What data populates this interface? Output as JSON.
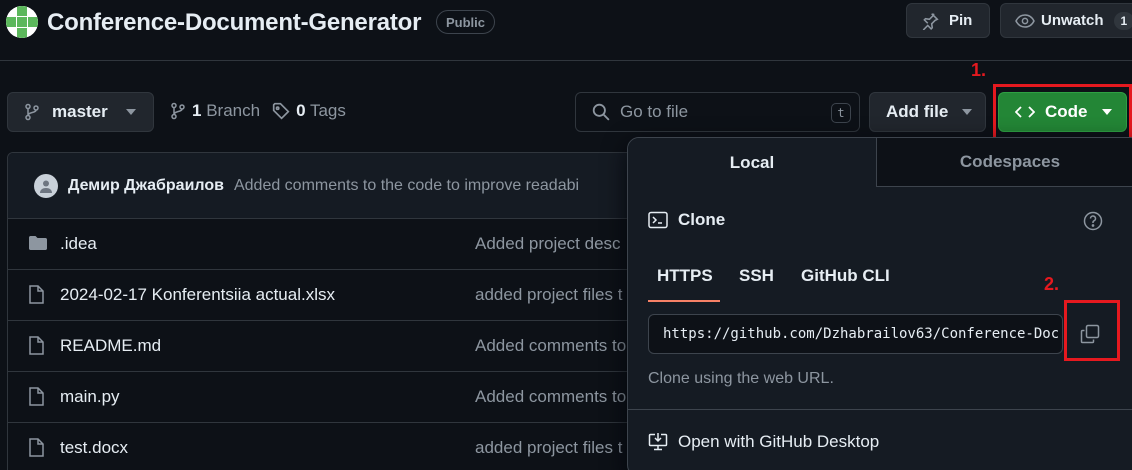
{
  "repo": {
    "name": "Conference-Document-Generator",
    "visibility": "Public"
  },
  "actions": {
    "pin_label": "Pin",
    "watch_label": "Unwatch",
    "watch_count": "1"
  },
  "branch": {
    "current": "master",
    "branch_count": "1",
    "branch_word": "Branch",
    "tag_count": "0",
    "tag_word": "Tags"
  },
  "search": {
    "placeholder": "Go to file",
    "shortcut": "t"
  },
  "buttons": {
    "add_file": "Add file",
    "code": "Code"
  },
  "commit": {
    "author": "Демир Джабраилов",
    "message": "Added comments to the code to improve readabi"
  },
  "files": [
    {
      "name": ".idea",
      "type": "folder",
      "message": "Added project desc"
    },
    {
      "name": "2024-02-17 Konferentsiia actual.xlsx",
      "type": "file",
      "message": "added project files t"
    },
    {
      "name": "README.md",
      "type": "file",
      "message": "Added comments to"
    },
    {
      "name": "main.py",
      "type": "file",
      "message": "Added comments to"
    },
    {
      "name": "test.docx",
      "type": "file",
      "message": "added project files t"
    }
  ],
  "code_panel": {
    "tabs": [
      "Local",
      "Codespaces"
    ],
    "clone_title": "Clone",
    "protocols": [
      "HTTPS",
      "SSH",
      "GitHub CLI"
    ],
    "active_protocol": "HTTPS",
    "url": "https://github.com/Dzhabrailov63/Conference-Doc",
    "hint": "Clone using the web URL.",
    "open_desktop": "Open with GitHub Desktop"
  },
  "annotations": {
    "marker_1": "1.",
    "marker_2": "2.",
    "color": "#e5191f"
  },
  "colors": {
    "background": "#0d1117",
    "primary_button": "#238636",
    "active_tab_underline": "#f78166"
  }
}
